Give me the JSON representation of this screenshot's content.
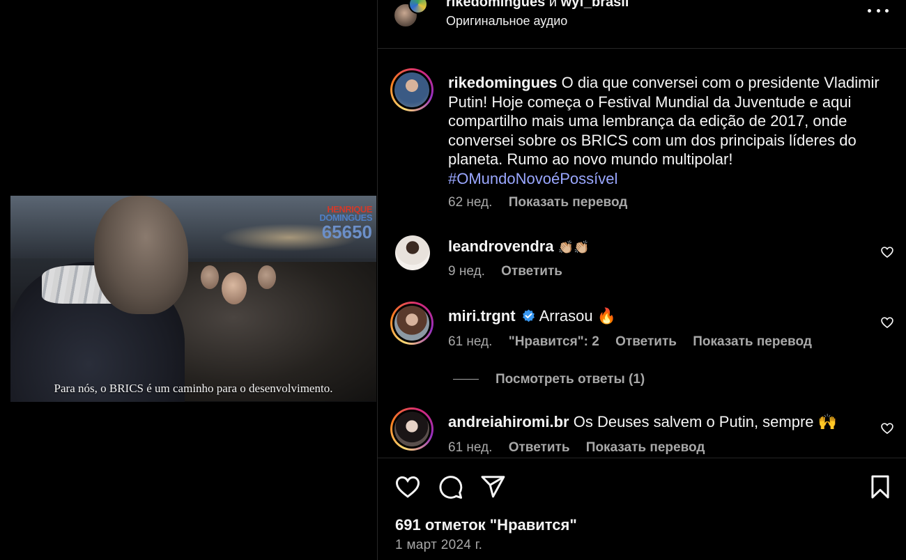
{
  "header": {
    "author1": "rikedomingues",
    "conjunction": "и",
    "author2": "wyf_brasil",
    "audio": "Оригинальное аудио"
  },
  "video": {
    "watermark_line1": "HENRIQUE",
    "watermark_line2": "DOMINGUES",
    "watermark_number": "65650",
    "subtitle": "Para nós, o BRICS é um caminho para o desenvolvimento."
  },
  "caption": {
    "username": "rikedomingues",
    "text": "O dia que conversei com o presidente Vladimir Putin! Hoje começa o Festival Mundial da Juventude e aqui compartilho mais uma lembrança da edição de 2017, onde conversei sobre os BRICS com um dos principais líderes do planeta. Rumo ao novo mundo multipolar!",
    "hashtag": "#OMundoNovoéPossível",
    "time": "62 нед.",
    "translate": "Показать перевод"
  },
  "comments": [
    {
      "username": "leandrovendra",
      "text": "👏🏼👏🏼",
      "time": "9 нед.",
      "reply": "Ответить"
    },
    {
      "username": "miri.trgnt",
      "verified": true,
      "text": "Arrasou 🔥",
      "time": "61 нед.",
      "likes": "\"Нравится\": 2",
      "reply": "Ответить",
      "translate": "Показать перевод",
      "view_replies": "Посмотреть ответы (1)"
    },
    {
      "username": "andreiahiromi.br",
      "text": "Os Deuses salvem o Putin, sempre 🙌",
      "time": "61 нед.",
      "reply": "Ответить",
      "translate": "Показать перевод"
    }
  ],
  "footer": {
    "likes": "691 отметок \"Нравится\"",
    "date": "1 март 2024 г."
  },
  "icons": {
    "more": "more-icon",
    "heart": "heart-icon",
    "comment": "comment-icon",
    "share": "share-icon",
    "save": "bookmark-icon",
    "verified": "verified-badge-icon"
  },
  "colors": {
    "background": "#000000",
    "text": "#f5f5f5",
    "secondary": "#a8a8a8",
    "hashtag": "#9aa7ff",
    "verified": "#3897f0",
    "divider": "#262626"
  }
}
